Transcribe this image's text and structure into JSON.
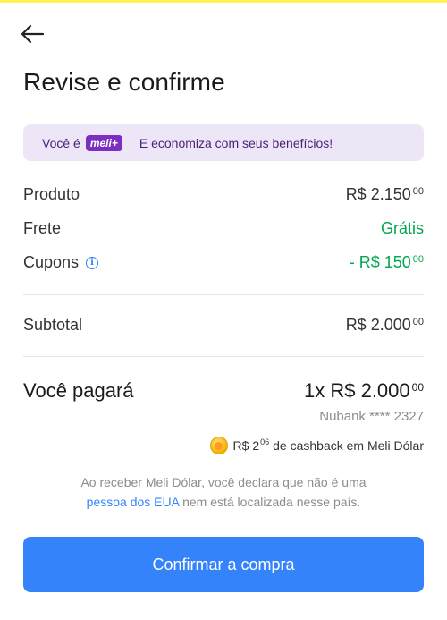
{
  "header": {
    "back_icon": "arrow-left-icon",
    "title": "Revise e confirme"
  },
  "banner": {
    "prefix": "Você é",
    "badge": "meli+",
    "text": "E economiza com seus benefícios!",
    "accent_color": "#7b2ebf"
  },
  "summary": {
    "product": {
      "label": "Produto",
      "value": "R$ 2.150",
      "cents": "00"
    },
    "shipping": {
      "label": "Frete",
      "value": "Grátis"
    },
    "coupons": {
      "label": "Cupons",
      "value": "- R$ 150",
      "cents": "00",
      "info_icon": "info-icon"
    },
    "subtotal": {
      "label": "Subtotal",
      "value": "R$ 2.000",
      "cents": "00"
    }
  },
  "payment": {
    "label": "Você pagará",
    "value": "1x R$ 2.000",
    "cents": "00",
    "card": "Nubank **** 2327",
    "cashback": {
      "icon": "coin-icon",
      "amount": "R$ 2",
      "cents": "06",
      "text": "de cashback em Meli Dólar"
    }
  },
  "disclaimer": {
    "before": "Ao receber Meli Dólar, você declara que não é uma",
    "link": "pessoa dos EUA",
    "after": "nem está localizada nesse país."
  },
  "confirm_button": "Confirmar a compra",
  "colors": {
    "primary": "#3483fa",
    "success": "#00a650",
    "muted": "#8c8c8c"
  }
}
